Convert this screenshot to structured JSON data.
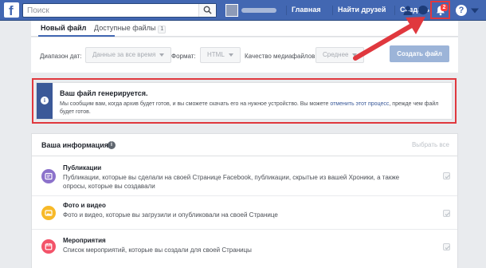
{
  "topbar": {
    "logo": "f",
    "search_placeholder": "Поиск",
    "nav": {
      "home": "Главная",
      "find_friends": "Найти друзей",
      "create": "Создать"
    },
    "notifications_count": "2",
    "help": "?"
  },
  "tabs": {
    "new_file": "Новый файл",
    "available_files": "Доступные файлы",
    "available_count": "1"
  },
  "filters": {
    "date_range_label": "Диапазон дат:",
    "date_range_value": "Данные за все время",
    "format_label": "Формат:",
    "format_value": "HTML",
    "quality_label": "Качество медиафайлов:",
    "quality_value": "Среднее",
    "create_button": "Создать файл"
  },
  "notice": {
    "title": "Ваш файл генерируется.",
    "text_before": "Мы сообщим вам, когда архив будет готов, и вы сможете скачать его на нужное устройство. Вы можете ",
    "link": "отменить этот процесс",
    "text_after": ", прежде чем файл будет готов."
  },
  "info": {
    "title": "Ваша информация",
    "select_all": "Выбрать все",
    "rows": [
      {
        "title": "Публикации",
        "desc": "Публикации, которые вы сделали на своей Странице Facebook, публикации, скрытые из вашей Хроники, а также опросы, которые вы создавали",
        "icon": "posts-icon",
        "color": "#8c72cb",
        "checked": true
      },
      {
        "title": "Фото и видео",
        "desc": "Фото и видео, которые вы загрузили и опубликовали на своей Странице",
        "icon": "photos-icon",
        "color": "#f7b928",
        "checked": true
      },
      {
        "title": "Мероприятия",
        "desc": "Список мероприятий, которые вы создали для своей Страницы",
        "icon": "events-icon",
        "color": "#f35369",
        "checked": true
      }
    ]
  },
  "colors": {
    "topbar": "#4267b2",
    "highlight": "#e0383e",
    "notice_bar": "#3b5998"
  }
}
